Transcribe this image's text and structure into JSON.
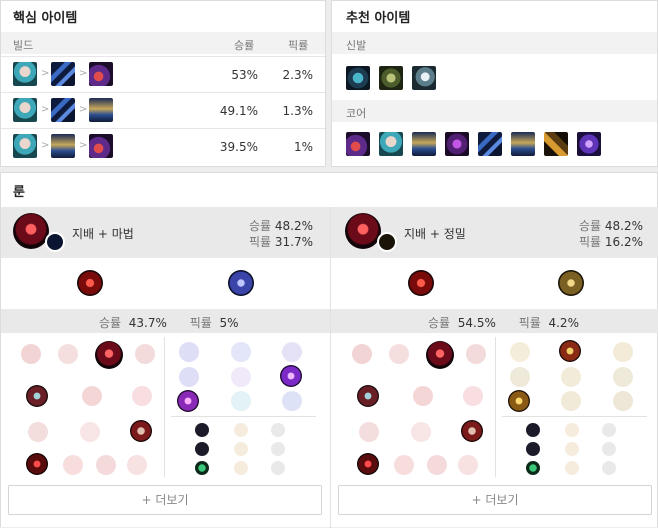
{
  "core_items": {
    "title": "핵심 아이템",
    "col_build": "빌드",
    "col_winrate": "승률",
    "col_pickrate": "픽률",
    "rows": [
      {
        "win": "53%",
        "pick": "2.3%"
      },
      {
        "win": "49.1%",
        "pick": "1.3%"
      },
      {
        "win": "39.5%",
        "pick": "1%"
      }
    ]
  },
  "recommended_items": {
    "title": "추천 아이템",
    "boots_label": "신발",
    "core_label": "코어"
  },
  "runes": {
    "title": "룬",
    "pages": [
      {
        "name": "지배 + 마법",
        "win_label": "승률",
        "win": "48.2%",
        "pick_label": "픽률",
        "pick": "31.7%",
        "sub_win_label": "승률",
        "sub_win": "43.7%",
        "sub_pick_label": "픽률",
        "sub_pick": "5%"
      },
      {
        "name": "지배 + 정밀",
        "win_label": "승률",
        "win": "48.2%",
        "pick_label": "픽률",
        "pick": "16.2%",
        "sub_win_label": "승률",
        "sub_win": "54.5%",
        "sub_pick_label": "픽률",
        "sub_pick": "4.2%"
      }
    ],
    "more_label": "+ 더보기"
  },
  "colors": {
    "accent": "#c22b2b",
    "sorcery": "#6f6bd8",
    "precision": "#c9a64e"
  }
}
